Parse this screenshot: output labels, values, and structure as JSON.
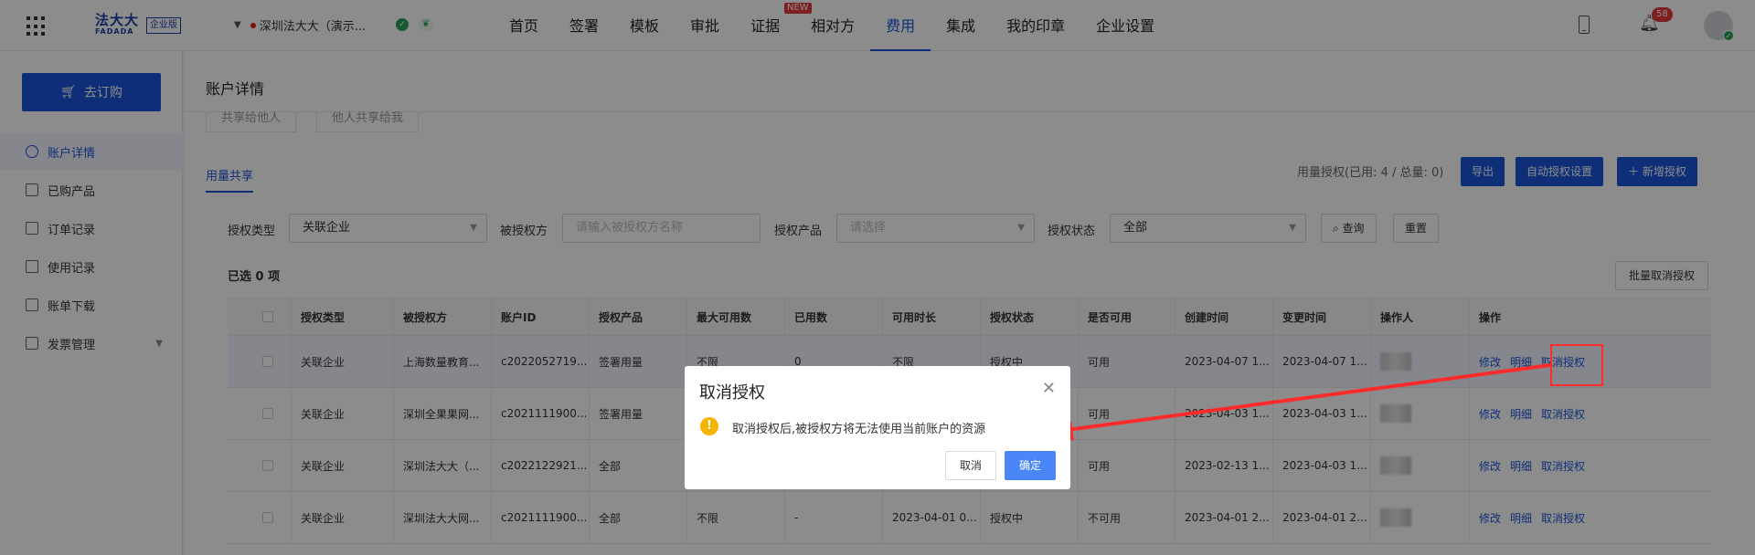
{
  "brand": {
    "logo_cn": "法大大",
    "logo_en": "FADADA",
    "edition": "企业版"
  },
  "org": {
    "name": "深圳法大大（演示..."
  },
  "nav": {
    "items": [
      "首页",
      "签署",
      "模板",
      "审批",
      "证据",
      "相对方",
      "费用",
      "集成",
      "我的印章",
      "企业设置"
    ],
    "active": "费用",
    "new_badge": "NEW",
    "notification_count": "58"
  },
  "sidebar": {
    "buy_label": "去订购",
    "items": [
      {
        "label": "账户详情",
        "active": true
      },
      {
        "label": "已购产品"
      },
      {
        "label": "订单记录"
      },
      {
        "label": "使用记录"
      },
      {
        "label": "账单下载"
      },
      {
        "label": "发票管理"
      }
    ]
  },
  "main": {
    "title": "账户详情",
    "tabs": [
      "共享给他人",
      "他人共享给我"
    ],
    "subtab": "用量共享",
    "usage_text": "用量授权(已用: 4 / 总量: 0)",
    "buttons": {
      "export": "导出",
      "auto_auth": "自动授权设置",
      "add_auth": "＋ 新增授权"
    },
    "filters": {
      "auth_type_label": "授权类型",
      "auth_type_value": "关联企业",
      "grantee_label": "被授权方",
      "grantee_placeholder": "请输入被授权方名称",
      "product_label": "授权产品",
      "product_placeholder": "请选择",
      "status_label": "授权状态",
      "status_value": "全部",
      "query": "查询",
      "reset": "重置"
    },
    "selected_text": "已选 0 项",
    "batch_cancel": "批量取消授权"
  },
  "table": {
    "headers": [
      "授权类型",
      "被授权方",
      "账户ID",
      "授权产品",
      "最大可用数",
      "已用数",
      "可用时长",
      "授权状态",
      "是否可用",
      "创建时间",
      "变更时间",
      "操作人",
      "操作"
    ],
    "actions": {
      "edit": "修改",
      "detail": "明细",
      "revoke": "取消授权"
    },
    "rows": [
      [
        "关联企业",
        "上海数量教育...",
        "c2022052719...",
        "签署用量",
        "不限",
        "0",
        "不限",
        "授权中",
        "可用",
        "2023-04-07 1...",
        "2023-04-07 1..."
      ],
      [
        "关联企业",
        "深圳全果果网...",
        "c2021111900...",
        "签署用量",
        "",
        "",
        "",
        "",
        "可用",
        "2023-04-03 1...",
        "2023-04-03 1..."
      ],
      [
        "关联企业",
        "深圳法大大（...",
        "c2022122921...",
        "全部",
        "",
        "",
        "",
        "",
        "可用",
        "2023-02-13 1...",
        "2023-04-03 1..."
      ],
      [
        "关联企业",
        "深圳法大大网...",
        "c2021111900...",
        "全部",
        "不限",
        "-",
        "2023-04-01 0...",
        "授权中",
        "不可用",
        "2023-04-01 2...",
        "2023-04-01 2..."
      ]
    ]
  },
  "modal": {
    "title": "取消授权",
    "message": "取消授权后,被授权方将无法使用当前账户的资源",
    "cancel": "取消",
    "ok": "确定"
  },
  "colors": {
    "primary": "#1a56db",
    "annotation_red": "#ff2a2a",
    "warning": "#f5b400"
  }
}
